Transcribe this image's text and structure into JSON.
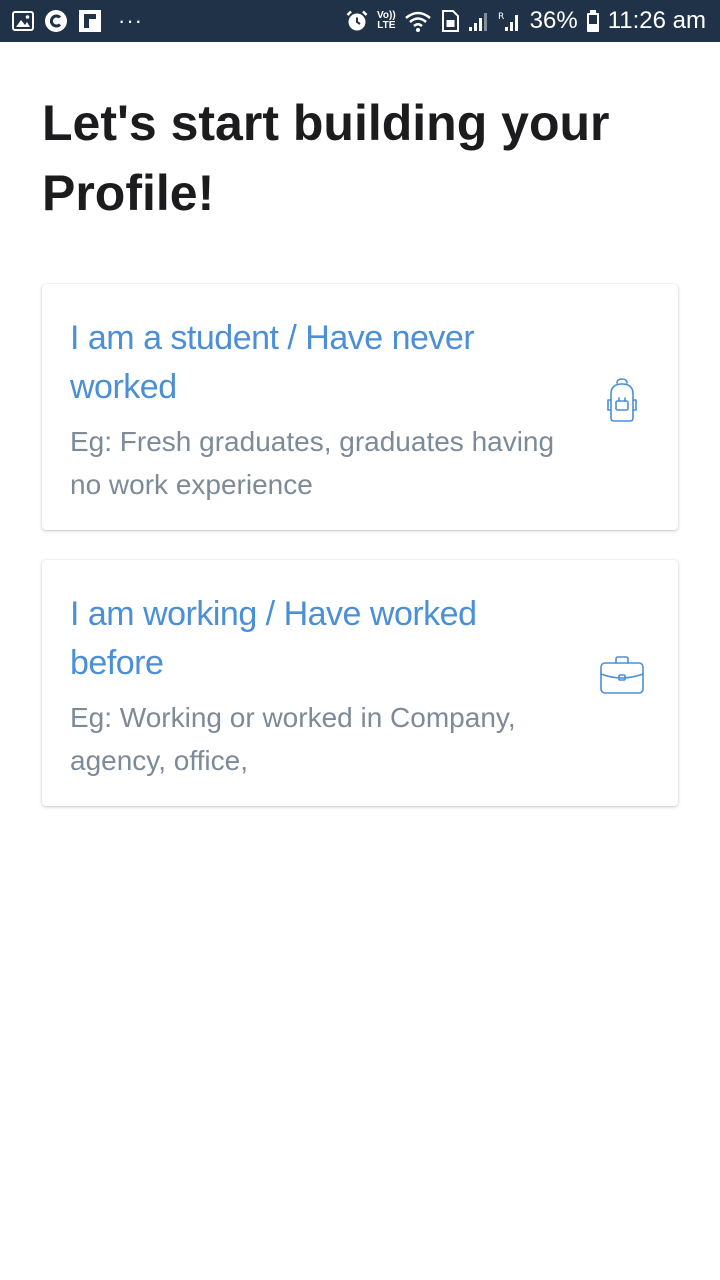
{
  "status_bar": {
    "icons_left": [
      "image-icon",
      "c-circle-icon",
      "flipboard-icon"
    ],
    "more_dots": "···",
    "icons_right": [
      "alarm-icon",
      "volte-icon",
      "wifi-icon",
      "sim-icon",
      "signal-icon",
      "signal-r-icon"
    ],
    "volte_top": "Vo))",
    "volte_bottom": "LTE",
    "battery_text": "36%",
    "time": "11:26 am",
    "background": "#203248"
  },
  "page": {
    "title": "Let's start building your Profile!"
  },
  "options": [
    {
      "title": "I am a student / Have never worked",
      "description": "Eg: Fresh graduates, graduates having no work experience",
      "icon": "backpack-icon"
    },
    {
      "title": "I am working / Have worked before",
      "description": "Eg: Working or worked in Company, agency, office,",
      "icon": "briefcase-icon"
    }
  ],
  "colors": {
    "title": "#1c1c1e",
    "card_title": "#4a8fd8",
    "card_desc": "#7d8a97"
  }
}
